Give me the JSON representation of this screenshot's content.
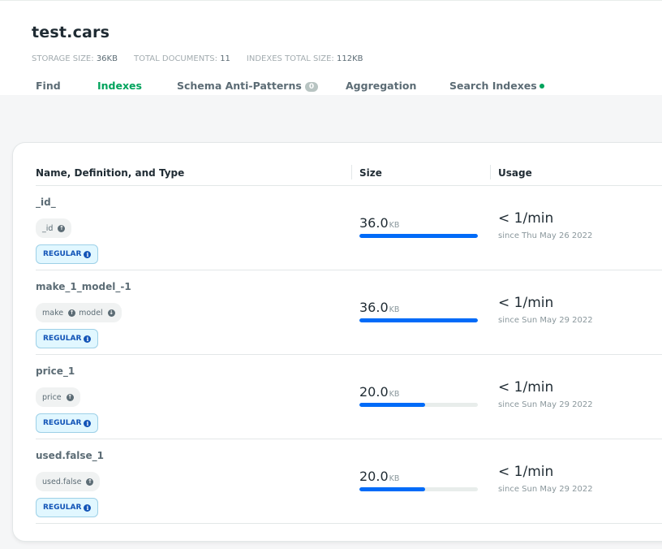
{
  "collection": {
    "title": "test.cars",
    "stats": [
      {
        "label": "STORAGE SIZE:",
        "value": "36KB"
      },
      {
        "label": "TOTAL DOCUMENTS:",
        "value": "11"
      },
      {
        "label": "INDEXES TOTAL SIZE:",
        "value": "112KB"
      }
    ]
  },
  "tabs": [
    {
      "label": "Find",
      "active": false
    },
    {
      "label": "Indexes",
      "active": true
    },
    {
      "label": "Schema Anti-Patterns",
      "badge": "0",
      "active": false
    },
    {
      "label": "Aggregation",
      "active": false
    },
    {
      "label": "Search Indexes",
      "active": false
    }
  ],
  "table": {
    "headers": [
      "Name, Definition, and Type",
      "Size",
      "Usage"
    ],
    "rows": [
      {
        "name": "_id_",
        "keys": [
          "_id"
        ],
        "type": "REGULAR",
        "size": "36.0",
        "unit": "KB",
        "size_fraction": 1.0,
        "usage": "< 1/min",
        "since": "since Thu May 26 2022"
      },
      {
        "name": "make_1_model_-1",
        "keys": [
          "make",
          "model"
        ],
        "type": "REGULAR",
        "size": "36.0",
        "unit": "KB",
        "size_fraction": 1.0,
        "usage": "< 1/min",
        "since": "since Sun May 29 2022"
      },
      {
        "name": "price_1",
        "keys": [
          "price"
        ],
        "type": "REGULAR",
        "size": "20.0",
        "unit": "KB",
        "size_fraction": 0.556,
        "usage": "< 1/min",
        "since": "since Sun May 29 2022"
      },
      {
        "name": "used.false_1",
        "keys": [
          "used.false"
        ],
        "type": "REGULAR",
        "size": "20.0",
        "unit": "KB",
        "size_fraction": 0.556,
        "usage": "< 1/min",
        "since": "since Sun May 29 2022"
      }
    ]
  },
  "colors": {
    "accent_green": "#00a35c",
    "bar_blue": "#016bf8",
    "badge_bg": "#e1f7ff"
  }
}
